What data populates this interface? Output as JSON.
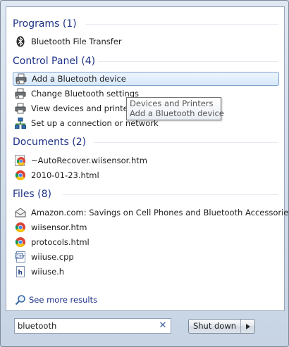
{
  "groups": {
    "programs": {
      "title": "Programs (1)",
      "items": [
        {
          "label": "Bluetooth File Transfer",
          "icon": "bluetooth-icon"
        }
      ]
    },
    "control_panel": {
      "title": "Control Panel (4)",
      "items": [
        {
          "label": "Add a Bluetooth device",
          "icon": "printer-icon"
        },
        {
          "label": "Change Bluetooth settings",
          "icon": "printer-icon"
        },
        {
          "label": "View devices and printers",
          "icon": "printer-icon"
        },
        {
          "label": "Set up a connection or network",
          "icon": "network-icon"
        }
      ]
    },
    "documents": {
      "title": "Documents (2)",
      "items": [
        {
          "label": "~AutoRecover.wiisensor.htm",
          "icon": "chrome-document-icon"
        },
        {
          "label": "2010-01-23.html",
          "icon": "chrome-icon"
        }
      ]
    },
    "files": {
      "title": "Files (8)",
      "items": [
        {
          "label": "Amazon.com: Savings on Cell Phones and Bluetooth Accessories",
          "icon": "email-icon"
        },
        {
          "label": "wiisensor.htm",
          "icon": "chrome-icon"
        },
        {
          "label": "protocols.html",
          "icon": "chrome-icon"
        },
        {
          "label": "wiiuse.cpp",
          "icon": "cpp-file-icon"
        },
        {
          "label": "wiiuse.h",
          "icon": "header-file-icon"
        }
      ]
    }
  },
  "tooltip": {
    "line1": "Devices and Printers",
    "line2": "Add a Bluetooth device"
  },
  "see_more": {
    "label": "See more results",
    "icon": "search-icon"
  },
  "search": {
    "value": "bluetooth",
    "clear_icon": "clear-icon"
  },
  "shutdown": {
    "label": "Shut down",
    "icon": "arrow-right-icon"
  },
  "colors": {
    "heading": "#1e3287",
    "selection_border": "#7da2ce",
    "chrome_red": "#db4437",
    "chrome_yellow": "#f4c20d",
    "chrome_green": "#0f9d58",
    "chrome_blue": "#4285f4"
  }
}
